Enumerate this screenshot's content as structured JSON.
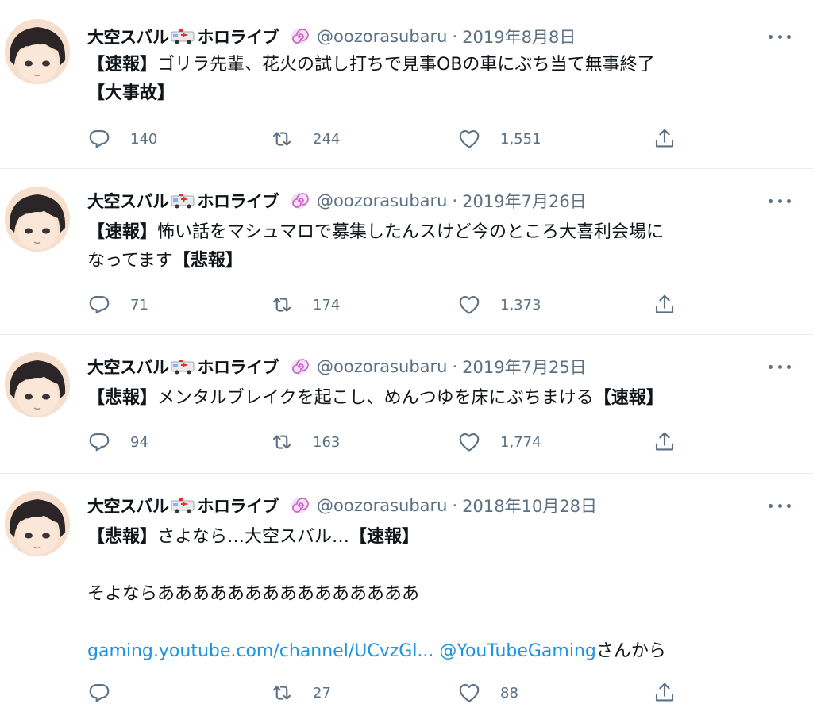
{
  "colors": {
    "link": "#1b95e0",
    "secondary": "#5b7083",
    "text": "#0f1419",
    "badge": "#c95ac9"
  },
  "tweets": [
    {
      "name": "大空スバル",
      "affiliation": "ホロライブ",
      "handle": "@oozorasubaru",
      "separator": "·",
      "date": "2019年8月8日",
      "lines": [
        {
          "tag": "【速報】",
          "text": "ゴリラ先輩、花火の試し打ちで見事OBの車にぶち当て無事終了"
        },
        {
          "tag": "【大事故】",
          "text": ""
        }
      ],
      "reply_count": "140",
      "retweet_count": "244",
      "like_count": "1,551"
    },
    {
      "name": "大空スバル",
      "affiliation": "ホロライブ",
      "handle": "@oozorasubaru",
      "separator": "·",
      "date": "2019年7月26日",
      "lines": [
        {
          "tag": "【速報】",
          "text": "怖い話をマシュマロで募集したんスけど今のところ大喜利会場に"
        },
        {
          "text": "なってます",
          "tag_end": "【悲報】"
        }
      ],
      "reply_count": "71",
      "retweet_count": "174",
      "like_count": "1,373"
    },
    {
      "name": "大空スバル",
      "affiliation": "ホロライブ",
      "handle": "@oozorasubaru",
      "separator": "·",
      "date": "2019年7月25日",
      "lines": [
        {
          "tag": "【悲報】",
          "text": "メンタルブレイクを起こし、めんつゆを床にぶちまける",
          "tag_end": "【速報】"
        }
      ],
      "reply_count": "94",
      "retweet_count": "163",
      "like_count": "1,774"
    },
    {
      "name": "大空スバル",
      "affiliation": "ホロライブ",
      "handle": "@oozorasubaru",
      "separator": "·",
      "date": "2018年10月28日",
      "lines": [
        {
          "tag": "【悲報】",
          "text": "さよなら…大空スバル…",
          "tag_end": "【速報】"
        },
        {
          "text": "そよならあああああああああああああああ"
        }
      ],
      "link_url": "gaming.youtube.com/channel/UCvzGl...",
      "link_mention": "@YouTubeGaming",
      "link_suffix": "さんから",
      "reply_count": "",
      "retweet_count": "27",
      "like_count": "88"
    }
  ]
}
